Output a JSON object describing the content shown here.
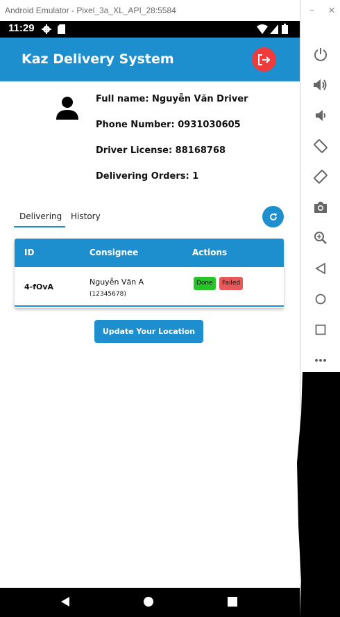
{
  "window": {
    "title": "Android Emulator - Pixel_3a_XL_API_28:5584"
  },
  "status_bar": {
    "time": "11:29"
  },
  "app": {
    "title": "Kaz Delivery System"
  },
  "profile": {
    "full_name": "Full name: Nguyễn Văn Driver",
    "phone": "Phone Number: 0931030605",
    "license": "Driver License: 88168768",
    "delivering_orders": "Delivering Orders: 1"
  },
  "tabs": [
    {
      "label": "Delivering",
      "active": true
    },
    {
      "label": "History",
      "active": false
    }
  ],
  "table": {
    "headers": {
      "id": "ID",
      "consignee": "Consignee",
      "actions": "Actions"
    },
    "rows": [
      {
        "id": "4-fOvA",
        "consignee_name": "Nguyễn Văn A",
        "consignee_phone": "(12345678)",
        "done_label": "Done",
        "failed_label": "Failed"
      }
    ]
  },
  "update_location_label": "Update Your Location",
  "colors": {
    "primary": "#1e8fce",
    "danger": "#ee3b3b",
    "done": "#27c527",
    "failed": "#e85a5a"
  },
  "emulator_controls": [
    "minimize-icon",
    "close-icon",
    "power-icon",
    "volume-up-icon",
    "volume-down-icon",
    "rotate-left-icon",
    "rotate-right-icon",
    "camera-icon",
    "zoom-icon",
    "back-icon",
    "home-icon",
    "overview-icon",
    "more-icon"
  ]
}
